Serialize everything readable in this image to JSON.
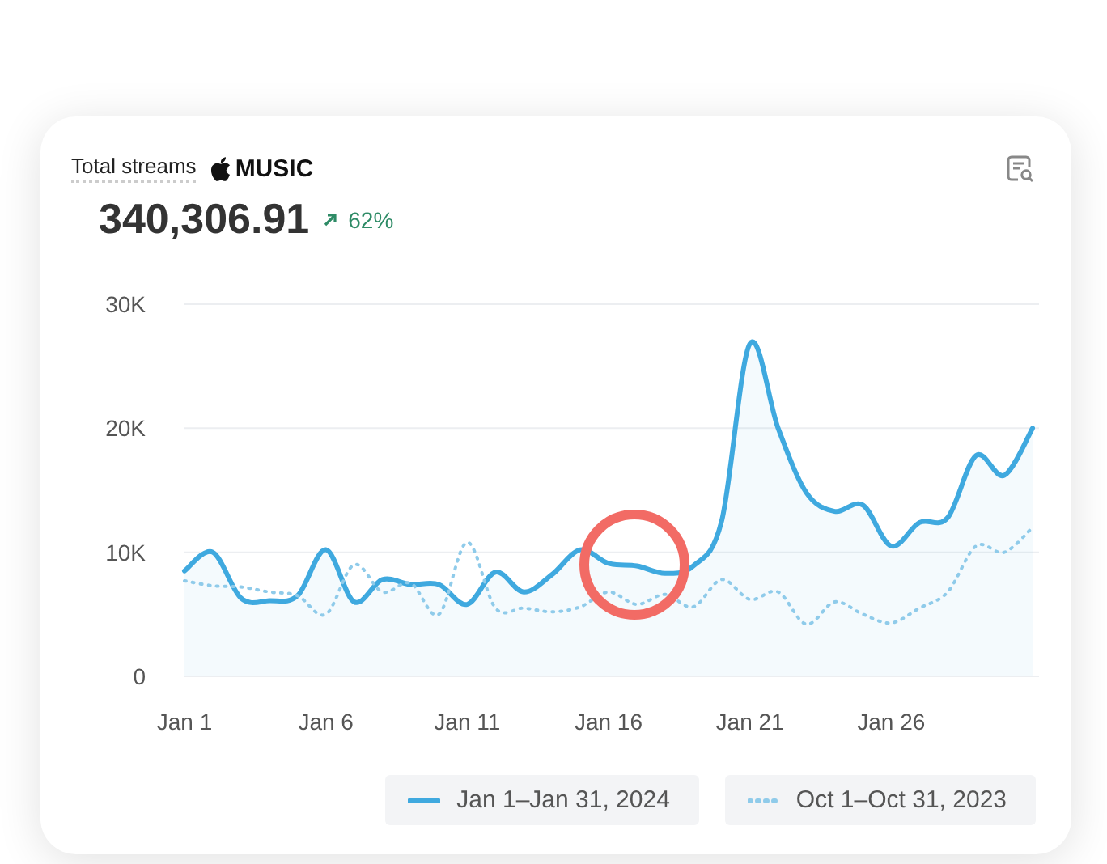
{
  "header": {
    "title": "Total streams",
    "service": "MUSIC"
  },
  "total": "340,306.91",
  "change": {
    "text": "62%"
  },
  "chart_data": {
    "type": "area",
    "categories": [
      "Jan 1",
      null,
      null,
      null,
      null,
      "Jan 6",
      null,
      null,
      null,
      null,
      "Jan 11",
      null,
      null,
      null,
      null,
      "Jan 16",
      null,
      null,
      null,
      null,
      "Jan 21",
      null,
      null,
      null,
      null,
      "Jan 26",
      null,
      null,
      null,
      null,
      null
    ],
    "ylim": [
      0,
      30000
    ],
    "yticks": [
      {
        "value": 0,
        "label": "0"
      },
      {
        "value": 10000,
        "label": "10K"
      },
      {
        "value": 20000,
        "label": "20K"
      },
      {
        "value": 30000,
        "label": "30K"
      }
    ],
    "series": [
      {
        "name": "Jan 1–Jan 31, 2024",
        "type": "area",
        "color": "#3fa9df",
        "line_style": "solid",
        "values": [
          8500,
          10000,
          6300,
          6100,
          6500,
          10200,
          6000,
          7800,
          7400,
          7400,
          5800,
          8400,
          6800,
          8200,
          10200,
          9100,
          8900,
          8300,
          8900,
          12500,
          26800,
          20000,
          14800,
          13300,
          13800,
          10500,
          12400,
          12800,
          17800,
          16200,
          20000
        ]
      },
      {
        "name": "Oct 1–Oct 31, 2023",
        "type": "line",
        "color": "#8fcbea",
        "line_style": "dotted",
        "values": [
          7700,
          7300,
          7200,
          6800,
          6500,
          5000,
          9000,
          6800,
          7500,
          5000,
          10800,
          5500,
          5500,
          5200,
          5600,
          6800,
          5800,
          6600,
          5600,
          7800,
          6200,
          6800,
          4200,
          6000,
          5000,
          4300,
          5500,
          6800,
          10500,
          10000,
          12000
        ]
      }
    ]
  }
}
